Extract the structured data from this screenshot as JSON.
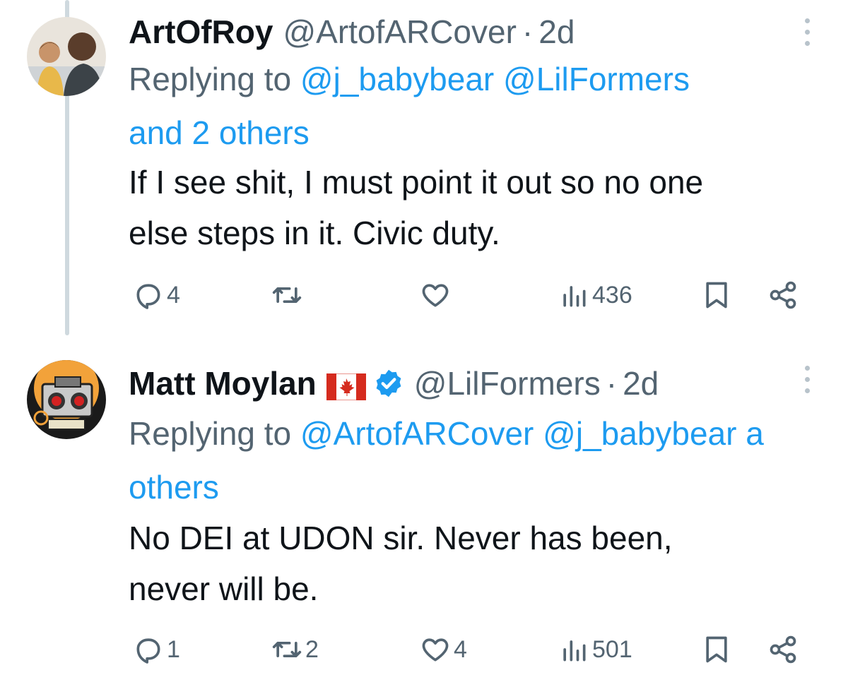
{
  "tweets": [
    {
      "name": "ArtOfRoy",
      "handle": "@ArtofARCover",
      "separator": "·",
      "time": "2d",
      "reply_prefix": "Replying to",
      "reply_mentions": "@j_babybear @LilFormers",
      "reply_suffix": "and 2 others",
      "text_line1": "If I see shit, I must point it out so no one",
      "text_line2": "else steps in it. Civic duty.",
      "replies": "4",
      "retweets": "",
      "likes": "",
      "views": "436",
      "verified": false,
      "flag": ""
    },
    {
      "name": "Matt Moylan",
      "handle": "@LilFormers",
      "separator": "·",
      "time": "2d",
      "reply_prefix": "Replying to",
      "reply_mentions": "@ArtofARCover @j_babybear a",
      "reply_suffix": "others",
      "text_line1": "No DEI at UDON sir. Never has been,",
      "text_line2": "never will be.",
      "replies": "1",
      "retweets": "2",
      "likes": "4",
      "views": "501",
      "verified": true,
      "flag": "canada-flag"
    }
  ],
  "colors": {
    "link": "#1d9bf0",
    "secondary": "#536471",
    "thread_line": "#cfd9de",
    "flag_red": "#d52b1e",
    "verified": "#1d9bf0"
  },
  "icons": [
    "reply-icon",
    "retweet-icon",
    "like-icon",
    "views-icon",
    "bookmark-icon",
    "share-icon",
    "more-icon",
    "verified-badge-icon",
    "canada-flag-icon"
  ]
}
